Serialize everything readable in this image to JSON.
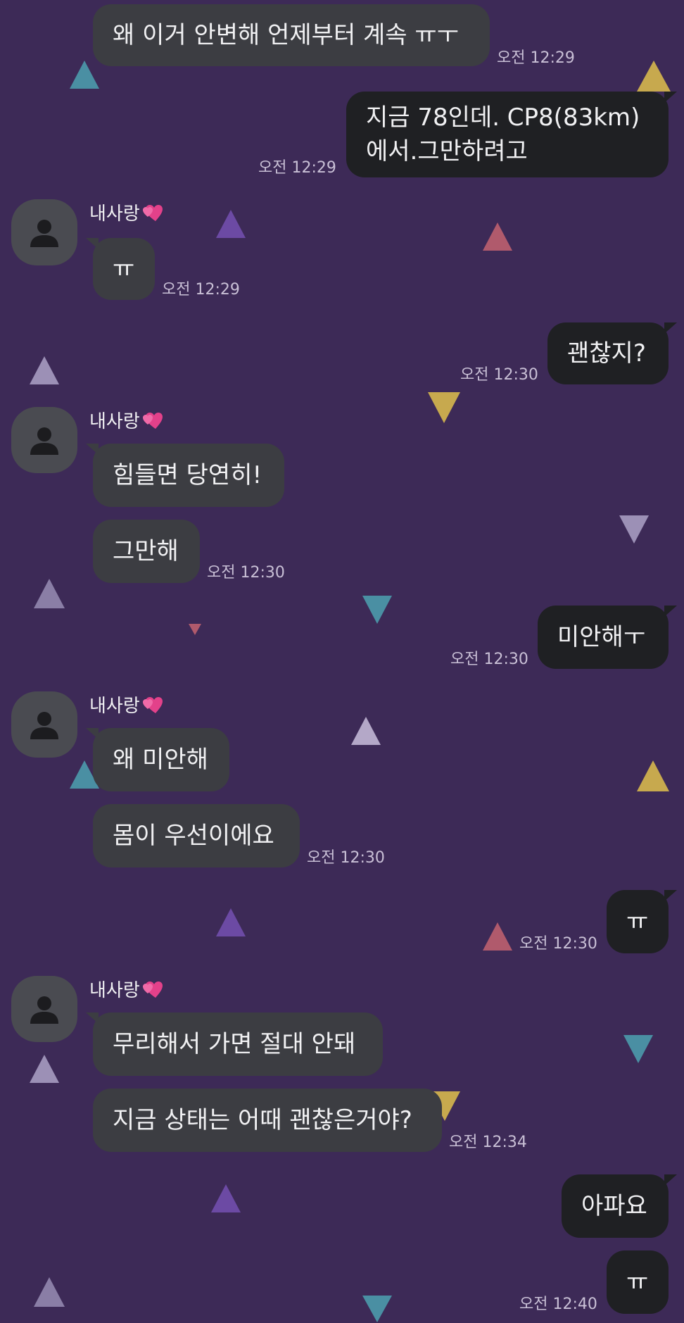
{
  "colors": {
    "background": "#3d2a57",
    "incoming_bubble": "#3c3d42",
    "outgoing_bubble": "#1f2023",
    "text": "#f1f1f3",
    "timestamp": "#c9c0d6",
    "avatar": "#4a4b51"
  },
  "contact": {
    "name": "내사랑",
    "name_emoji_icon": "two-hearts-icon",
    "avatar_icon": "default-person-icon"
  },
  "messages": [
    {
      "dir": "in",
      "lines": [
        "왜 이거 안변해 언제부터 계속 ㅠㅜ"
      ],
      "time": "오전 12:29"
    },
    {
      "dir": "out",
      "lines": [
        "지금 78인데. CP8(83km)",
        "에서.그만하려고"
      ],
      "time": "오전 12:29"
    },
    {
      "dir": "in",
      "lines": [
        "ㅠ"
      ],
      "time": "오전 12:29"
    },
    {
      "dir": "out",
      "lines": [
        "괜찮지?"
      ],
      "time": "오전 12:30"
    },
    {
      "dir": "in",
      "lines": [
        "힘들면 당연히!"
      ],
      "time": ""
    },
    {
      "dir": "in",
      "lines": [
        "그만해"
      ],
      "time": "오전 12:30"
    },
    {
      "dir": "out",
      "lines": [
        "미안해ㅜ"
      ],
      "time": "오전 12:30"
    },
    {
      "dir": "in",
      "lines": [
        "왜 미안해"
      ],
      "time": ""
    },
    {
      "dir": "in",
      "lines": [
        "몸이 우선이에요"
      ],
      "time": "오전 12:30"
    },
    {
      "dir": "out",
      "lines": [
        "ㅠ"
      ],
      "time": "오전 12:30"
    },
    {
      "dir": "in",
      "lines": [
        "무리해서 가면 절대 안돼"
      ],
      "time": ""
    },
    {
      "dir": "in",
      "lines": [
        "지금 상태는 어때 괜찮은거야?"
      ],
      "time": "오전 12:34"
    },
    {
      "dir": "out",
      "lines": [
        "아파요"
      ],
      "time": ""
    },
    {
      "dir": "out",
      "lines": [
        "ㅠ"
      ],
      "time": "오전 12:40"
    }
  ]
}
